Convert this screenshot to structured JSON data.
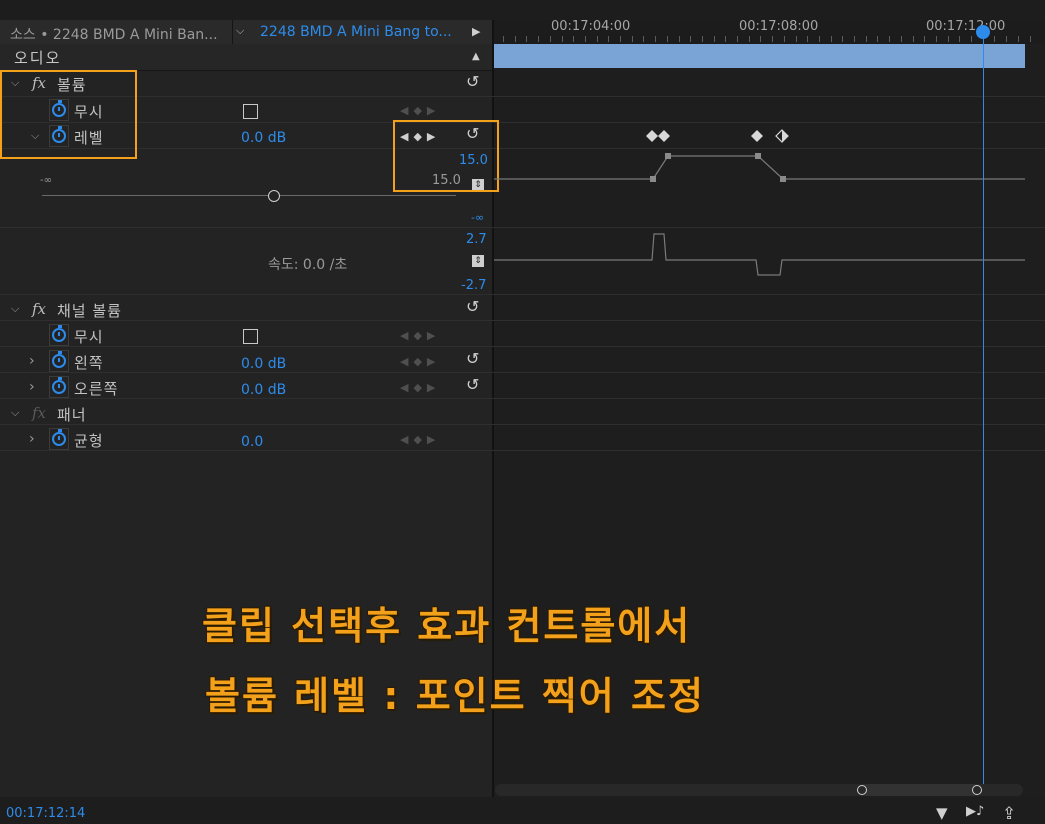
{
  "header": {
    "source_tab": "소스 • 2248 BMD A Mini Ban...",
    "sequence_tab": "2248 BMD A Mini Bang to...",
    "chevron": "⌵",
    "play_icon": "▶"
  },
  "ruler": {
    "labels": [
      "00:17:04:00",
      "00:17:08:00",
      "00:17:12:00"
    ]
  },
  "audio_section": {
    "label": "오디오",
    "collapse_icon": "▲"
  },
  "effects": {
    "volume": {
      "fx": "fx",
      "name": "볼륨",
      "bypass_label": "무시",
      "level_label": "레벨",
      "level_value": "0.0 dB",
      "graph_max": "15.0",
      "graph_current": "15.0",
      "graph_min_left": "-∞",
      "graph_min_right": "-∞",
      "velocity_label": "속도: 0.0 /초",
      "velocity_max": "2.7",
      "velocity_min": "-2.7"
    },
    "channel_volume": {
      "fx": "fx",
      "name": "채널 볼륨",
      "bypass_label": "무시",
      "left_label": "왼쪽",
      "left_value": "0.0 dB",
      "right_label": "오른쪽",
      "right_value": "0.0 dB"
    },
    "panner": {
      "fx": "fx",
      "name": "패너",
      "balance_label": "균형",
      "balance_value": "0.0"
    }
  },
  "icons": {
    "chevron_down": "⌵",
    "chevron_right": "›",
    "keyframe_nav": "◀◆▶",
    "reset": "↺",
    "updown": "⇕"
  },
  "caption": {
    "line1": "클립 선택후 효과 컨트롤에서",
    "line2": "볼륨 레벨 : 포인트 찍어 조정"
  },
  "footer": {
    "timecode": "00:17:12:14",
    "filter_icon": "▼",
    "play_audio_icon": "▶♪",
    "export_icon": "⇪"
  },
  "colors": {
    "accent": "#2d8ceb",
    "highlight": "#f3a11b",
    "clip_bar": "#7aa3d6"
  }
}
